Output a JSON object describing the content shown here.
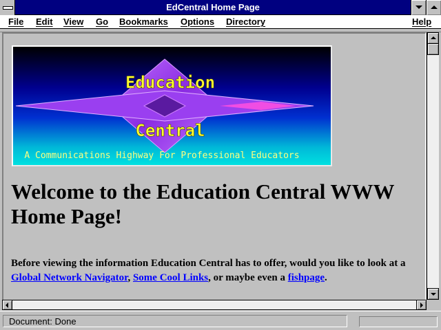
{
  "window": {
    "title": "EdCentral Home Page"
  },
  "menu": [
    "File",
    "Edit",
    "View",
    "Go",
    "Bookmarks",
    "Options",
    "Directory",
    "Help"
  ],
  "banner": {
    "line1": "Education",
    "line2": "Central",
    "tagline": "A Communications Highway For Professional Educators"
  },
  "content": {
    "heading": "Welcome to the Education Central WWW Home Page!",
    "para_before": "Before viewing the information Education Central has to offer, would you like to look at a ",
    "link1": "Global Network Navigator",
    "sep1": ", ",
    "link2": "Some Cool Links",
    "sep2": ", or maybe even a ",
    "link3": "fishpage",
    "para_after": "."
  },
  "status": {
    "text": "Document: Done",
    "progress_percent": 0
  },
  "colors": {
    "titlebar": "#000080",
    "link": "#0000ff",
    "banner_text": "#ffff00",
    "diamond": "#a040e0"
  }
}
